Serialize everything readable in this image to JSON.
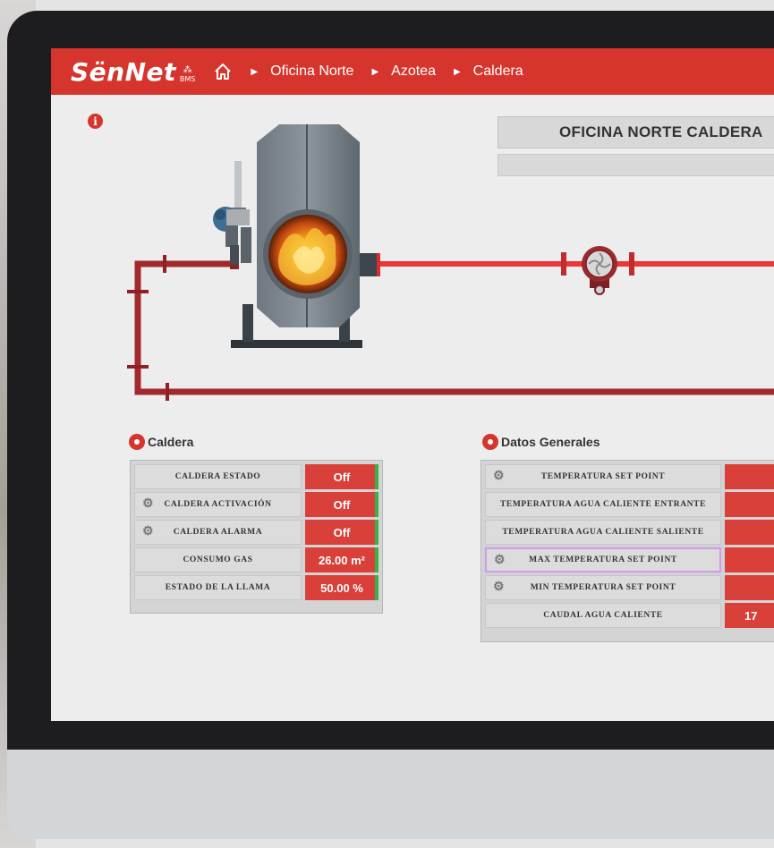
{
  "app": {
    "logo_text": "SënNet",
    "logo_sub": "BMS"
  },
  "breadcrumb": {
    "items": [
      "Oficina Norte",
      "Azotea",
      "Caldera"
    ]
  },
  "header": {
    "title": "OFICINA NORTE CALDERA"
  },
  "caldera_panel": {
    "title": "Caldera",
    "rows": [
      {
        "label": "CALDERA ESTADO",
        "value": "Off",
        "gear": false
      },
      {
        "label": "CALDERA ACTIVACIÓN",
        "value": "Off",
        "gear": true
      },
      {
        "label": "CALDERA ALARMA",
        "value": "Off",
        "gear": true
      },
      {
        "label": "CONSUMO GAS",
        "value": "26.00 m²",
        "gear": false
      },
      {
        "label": "ESTADO DE LA LLAMA",
        "value": "50.00 %",
        "gear": false
      }
    ]
  },
  "datos_panel": {
    "title": "Datos Generales",
    "rows": [
      {
        "label": "TEMPERATURA SET POINT",
        "value": "",
        "gear": true
      },
      {
        "label": "TEMPERATURA AGUA CALIENTE ENTRANTE",
        "value": "",
        "gear": false
      },
      {
        "label": "TEMPERATURA AGUA CALIENTE SALIENTE",
        "value": "",
        "gear": false
      },
      {
        "label": "MAX TEMPERATURA SET POINT",
        "value": "",
        "gear": true
      },
      {
        "label": "MIN TEMPERATURA SET POINT",
        "value": "",
        "gear": true
      },
      {
        "label": "CAUDAL AGUA CALIENTE",
        "value": "17",
        "gear": false
      }
    ]
  },
  "colors": {
    "accent": "#d6352e",
    "status_ok": "#35b44a",
    "pipe_supply": "#e8383a",
    "pipe_return": "#a3282d"
  },
  "icons": {
    "home": "home-icon",
    "info": "info-icon",
    "location": "location-pin-icon",
    "settings": "gear-icon"
  }
}
